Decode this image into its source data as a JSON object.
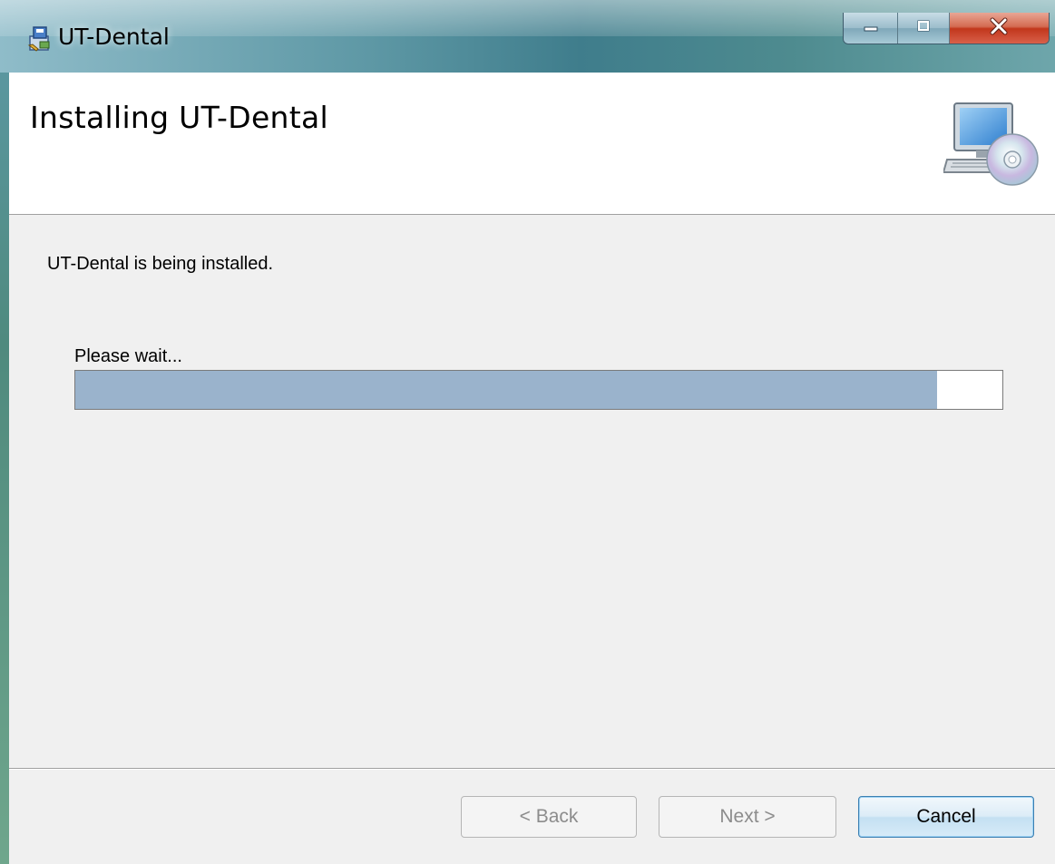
{
  "window": {
    "title": "UT-Dental",
    "icon": "installer-icon",
    "controls": {
      "minimize_icon": "minimize-icon",
      "maximize_icon": "maximize-icon",
      "close_icon": "close-icon"
    }
  },
  "header": {
    "title": "Installing UT-Dental",
    "icon": "computer-disc-setup-icon"
  },
  "body": {
    "status": "UT-Dental is being installed.",
    "wait_label": "Please wait...",
    "progress_percent": 93
  },
  "buttons": {
    "back": {
      "label": "< Back",
      "enabled": false
    },
    "next": {
      "label": "Next >",
      "enabled": false
    },
    "cancel": {
      "label": "Cancel",
      "enabled": true
    }
  },
  "colors": {
    "progress_fill": "#9ab3cc",
    "client_background": "#f0f0f0",
    "close_button": "#c2371c"
  }
}
